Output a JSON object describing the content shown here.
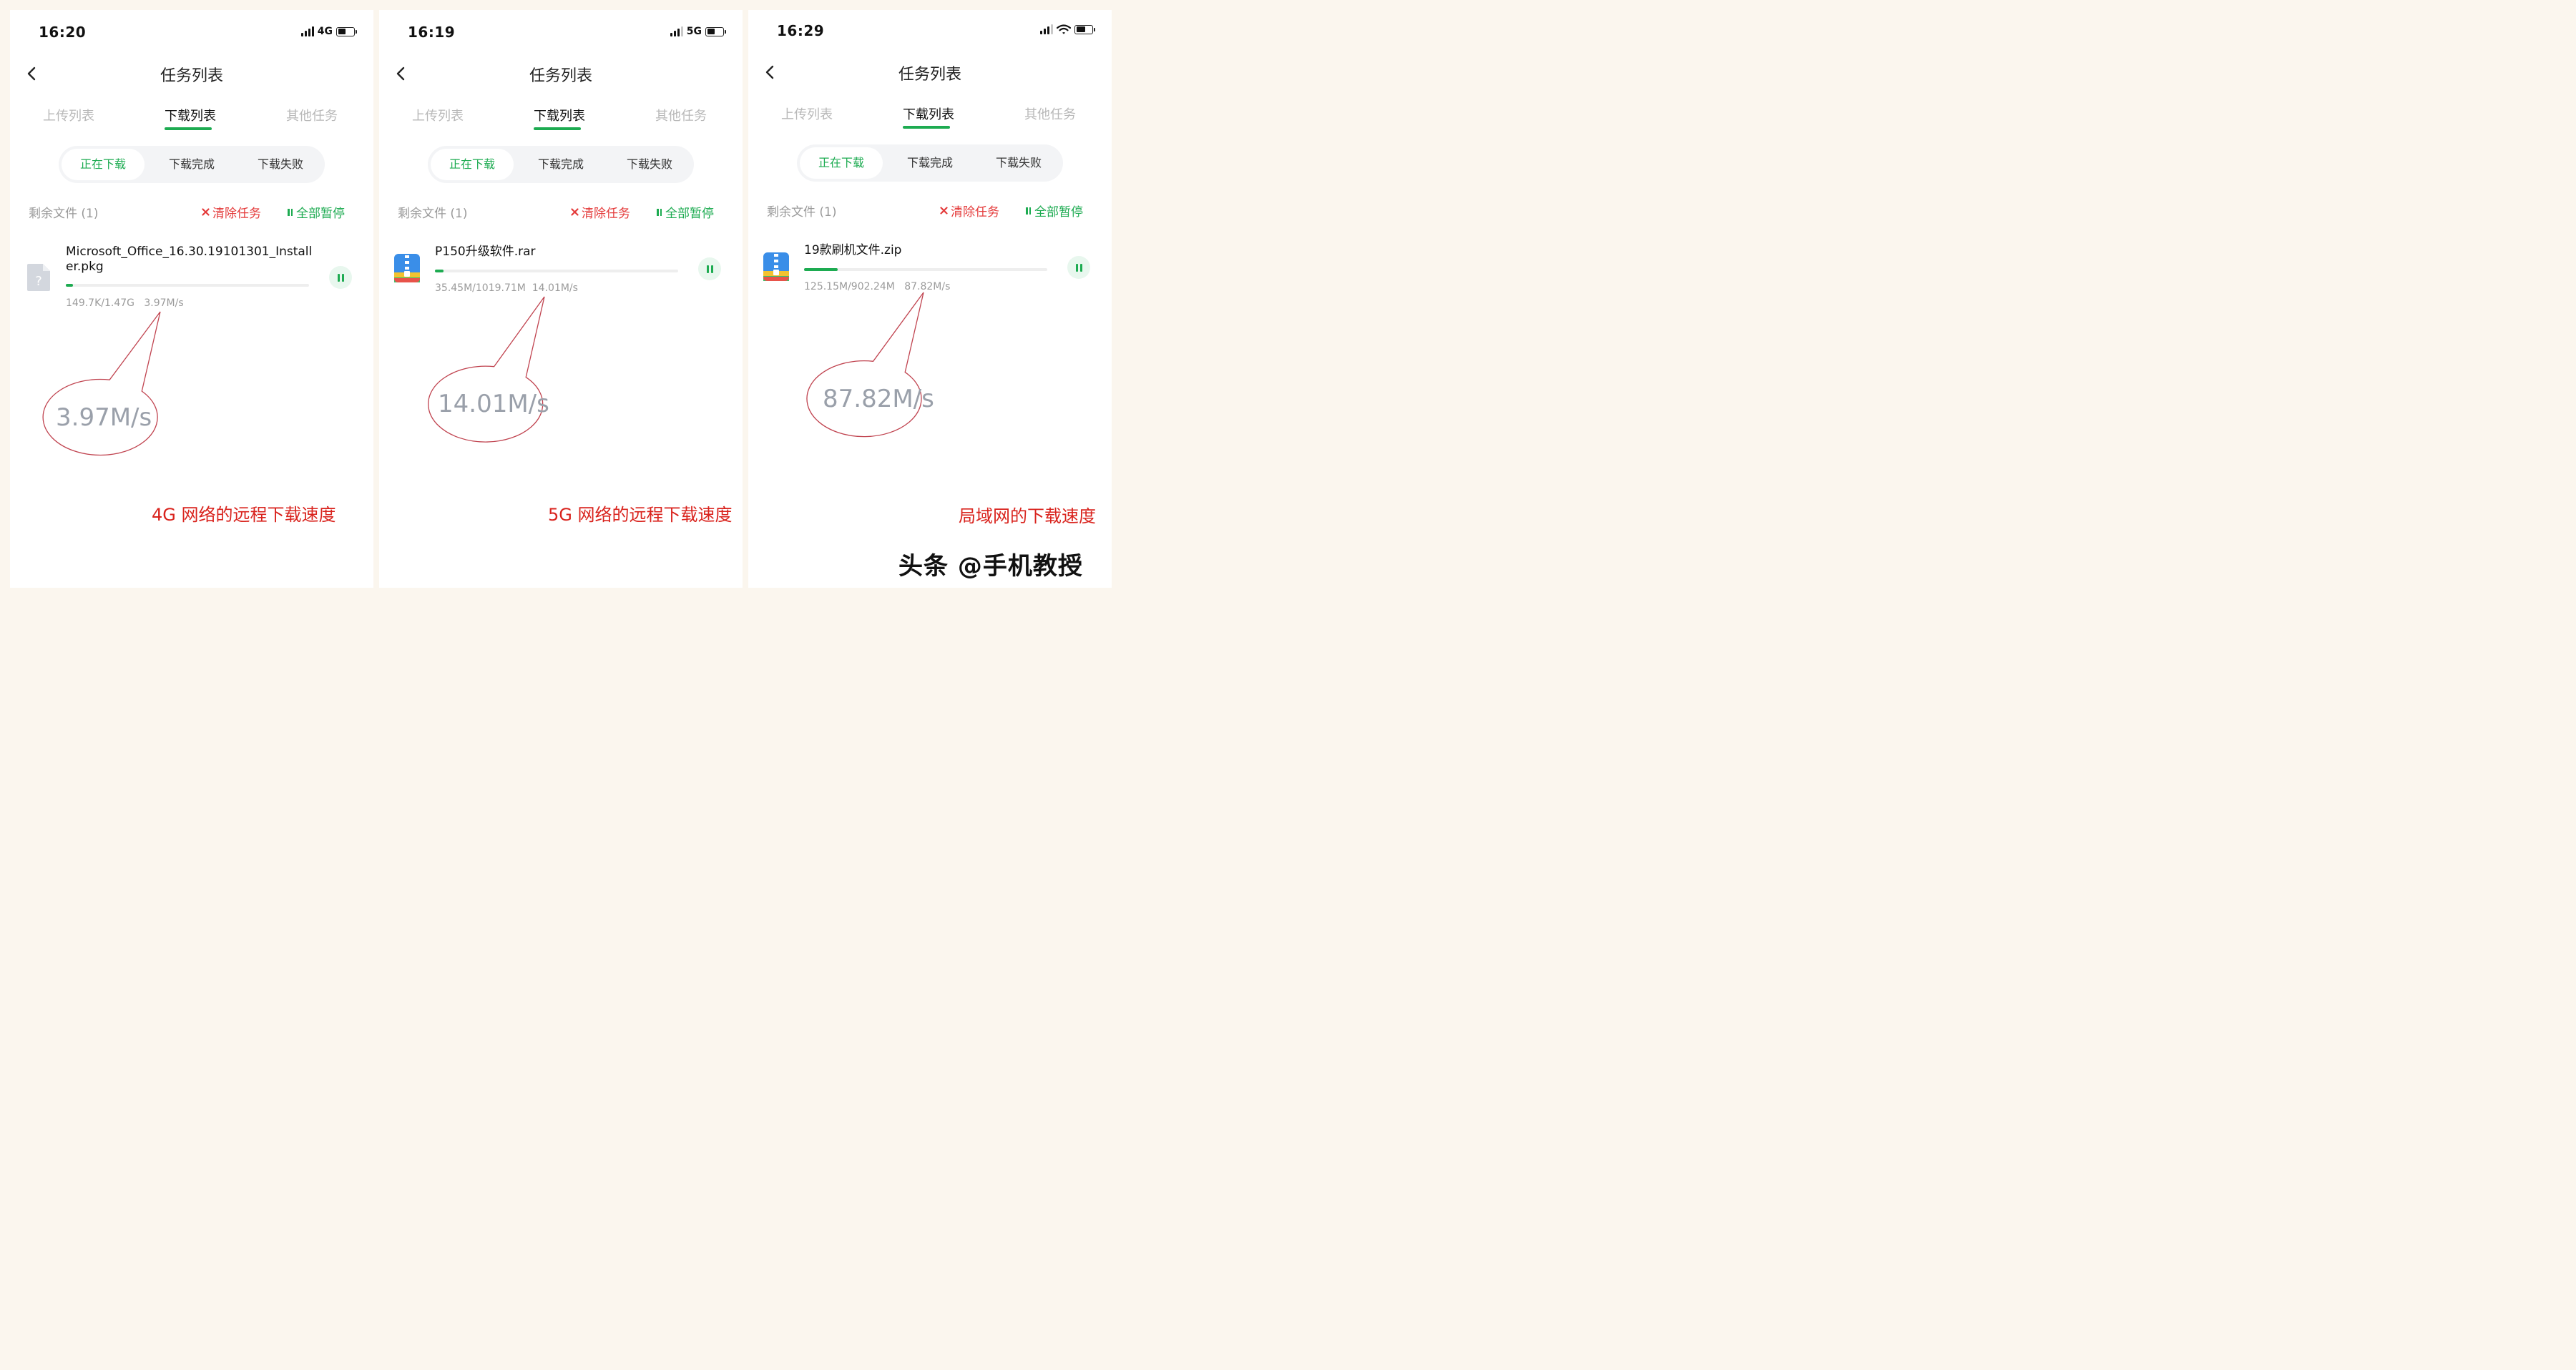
{
  "colors": {
    "accent": "#1dab51",
    "danger": "#e43b3b",
    "annotation": "#d9231d",
    "ellipse": "#c0434f"
  },
  "screens": [
    {
      "time": "16:20",
      "network": "4G",
      "title": "任务列表",
      "tabs": [
        "上传列表",
        "下载列表",
        "其他任务"
      ],
      "segments": [
        "正在下载",
        "下载完成",
        "下载失败"
      ],
      "remaining": "剩余文件 (1)",
      "clear_label": "清除任务",
      "pause_all_label": "全部暂停",
      "file": {
        "name": "Microsoft_Office_16.30.19101301_Installer.pkg",
        "icon": "unknown-file-icon",
        "progress": 0.03,
        "size": "149.7K/1.47G",
        "speed": "3.97M/s"
      },
      "callout": "3.97M/s",
      "caption": "4G 网络的远程下载速度"
    },
    {
      "time": "16:19",
      "network": "5G",
      "title": "任务列表",
      "tabs": [
        "上传列表",
        "下载列表",
        "其他任务"
      ],
      "segments": [
        "正在下载",
        "下载完成",
        "下载失败"
      ],
      "remaining": "剩余文件 (1)",
      "clear_label": "清除任务",
      "pause_all_label": "全部暂停",
      "file": {
        "name": "P150升级软件.rar",
        "icon": "zip-archive-icon",
        "progress": 0.035,
        "size": "35.45M/1019.71M",
        "speed": "14.01M/s"
      },
      "callout": "14.01M/s",
      "caption": "5G 网络的远程下载速度"
    },
    {
      "time": "16:29",
      "network": "wifi",
      "title": "任务列表",
      "tabs": [
        "上传列表",
        "下载列表",
        "其他任务"
      ],
      "segments": [
        "正在下载",
        "下载完成",
        "下载失败"
      ],
      "remaining": "剩余文件 (1)",
      "clear_label": "清除任务",
      "pause_all_label": "全部暂停",
      "file": {
        "name": "19款刷机文件.zip",
        "icon": "zip-archive-icon",
        "progress": 0.139,
        "size": "125.15M/902.24M",
        "speed": "87.82M/s"
      },
      "callout": "87.82M/s",
      "caption": "局域网的下载速度"
    }
  ],
  "watermark": "头条 @手机教授"
}
